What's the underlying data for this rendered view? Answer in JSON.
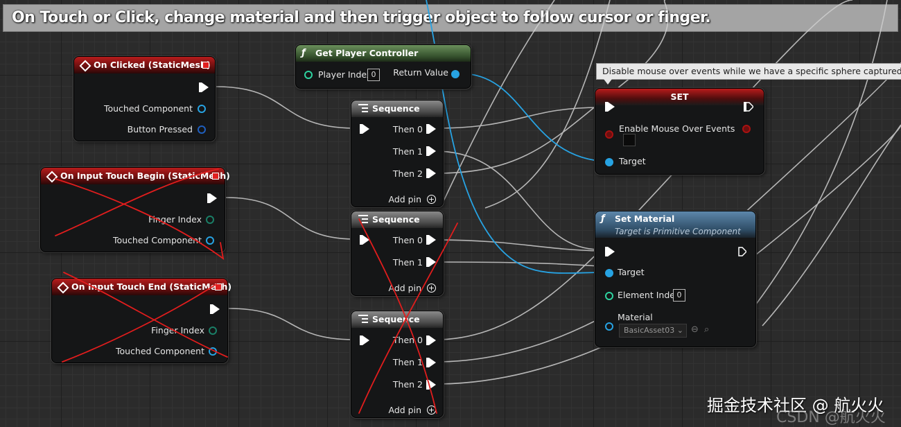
{
  "comment": "On Touch or Click, change material and then trigger object to follow cursor or finger.",
  "tooltip": "Disable mouse over events while we have a specific sphere captured",
  "nodes": {
    "on_clicked": {
      "title": "On Clicked (StaticMesh)",
      "pins": [
        "Touched Component",
        "Button Pressed"
      ]
    },
    "touch_begin": {
      "title": "On Input Touch Begin (StaticMesh)",
      "pins": [
        "Finger Index",
        "Touched Component"
      ]
    },
    "touch_end": {
      "title": "On Input Touch End (StaticMesh)",
      "pins": [
        "Finger Index",
        "Touched Component"
      ]
    },
    "get_pc": {
      "title": "Get Player Controller",
      "player_index_label": "Player Index",
      "player_index_value": "0",
      "return_label": "Return Value"
    },
    "seq1": {
      "title": "Sequence",
      "outs": [
        "Then 0",
        "Then 1",
        "Then 2"
      ],
      "add": "Add pin"
    },
    "seq2": {
      "title": "Sequence",
      "outs": [
        "Then 0",
        "Then 1"
      ],
      "add": "Add pin"
    },
    "seq3": {
      "title": "Sequence",
      "outs": [
        "Then 0",
        "Then 1",
        "Then 2"
      ],
      "add": "Add pin"
    },
    "set": {
      "title": "SET",
      "var": "Enable Mouse Over Events",
      "target": "Target"
    },
    "set_material": {
      "title": "Set Material",
      "subtitle": "Target is Primitive Component",
      "target": "Target",
      "element_index": "Element Index",
      "element_index_value": "0",
      "material": "Material",
      "material_value": "BasicAsset03"
    }
  },
  "watermark": "掘金技术社区 @ 航火火",
  "watermark2": "CSDN @航火火",
  "colors": {
    "event_header": "#b81c1c",
    "pure_header": "#5a7a4c",
    "call_header": "#4f7596",
    "exec_wire": "#ffffff",
    "object_wire": "#27a3e3",
    "strike": "#e11d1d"
  }
}
